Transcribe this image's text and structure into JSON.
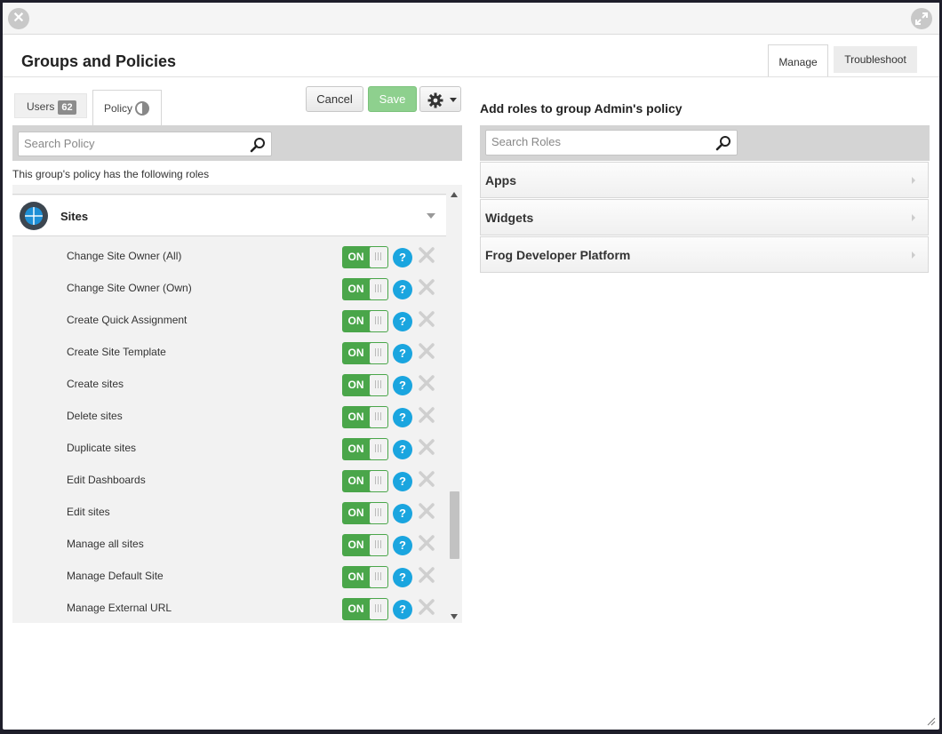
{
  "window": {
    "title": "Groups and Policies",
    "tabs": [
      {
        "label": "Manage",
        "active": true
      },
      {
        "label": "Troubleshoot",
        "active": false
      }
    ]
  },
  "left": {
    "subtabs": {
      "users_label": "Users",
      "users_count": "62",
      "policy_label": "Policy"
    },
    "buttons": {
      "cancel": "Cancel",
      "save": "Save"
    },
    "search": {
      "placeholder": "Search Policy"
    },
    "note": "This group's policy has the following roles",
    "section": {
      "title": "Sites",
      "icon": "globe-icon",
      "roles": [
        {
          "label": "Change Site Owner (All)",
          "state": "ON"
        },
        {
          "label": "Change Site Owner (Own)",
          "state": "ON"
        },
        {
          "label": "Create Quick Assignment",
          "state": "ON"
        },
        {
          "label": "Create Site Template",
          "state": "ON"
        },
        {
          "label": "Create sites",
          "state": "ON"
        },
        {
          "label": "Delete sites",
          "state": "ON"
        },
        {
          "label": "Duplicate sites",
          "state": "ON"
        },
        {
          "label": "Edit Dashboards",
          "state": "ON"
        },
        {
          "label": "Edit sites",
          "state": "ON"
        },
        {
          "label": "Manage all sites",
          "state": "ON"
        },
        {
          "label": "Manage Default Site",
          "state": "ON"
        },
        {
          "label": "Manage External URL",
          "state": "ON"
        }
      ]
    }
  },
  "right": {
    "title": "Add roles to group Admin's policy",
    "search": {
      "placeholder": "Search Roles"
    },
    "categories": [
      {
        "label": "Apps"
      },
      {
        "label": "Widgets"
      },
      {
        "label": "Frog Developer Platform"
      }
    ]
  },
  "colors": {
    "toggle_on": "#4aa64a",
    "help": "#1aa5df",
    "save": "#8ed08e"
  }
}
